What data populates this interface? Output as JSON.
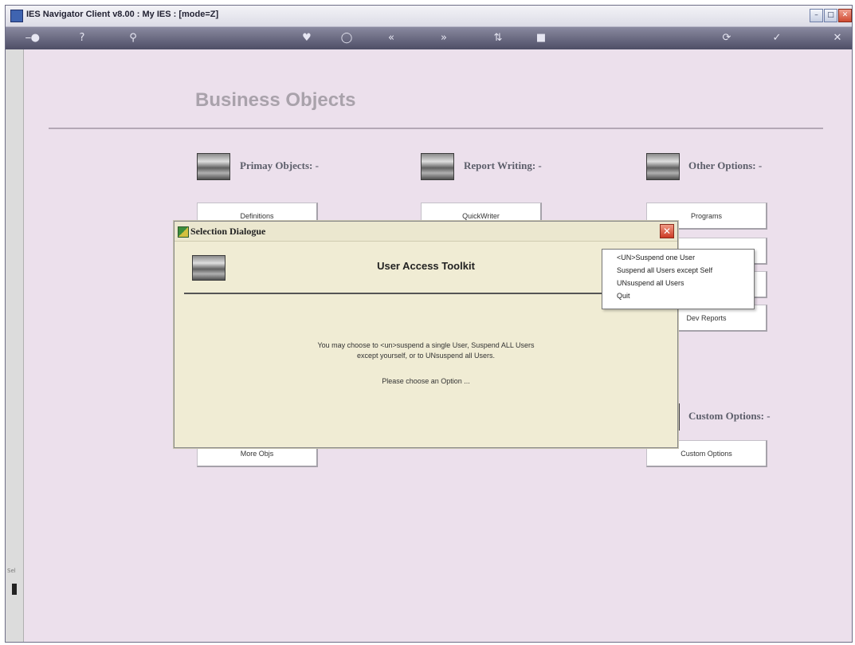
{
  "window": {
    "title": "IES Navigator Client v8.00 : My IES :       [mode=Z]"
  },
  "page": {
    "title": "Business Objects"
  },
  "sections": {
    "primary": {
      "title": "Primay Objects: -"
    },
    "report": {
      "title": "Report Writing: -"
    },
    "other": {
      "title": "Other Options: -"
    },
    "custom": {
      "title": "Custom Options: -"
    }
  },
  "buttons": {
    "definitions": "Definitions",
    "quickwriter": "QuickWriter",
    "programs": "Programs",
    "dev_reports": "Dev Reports",
    "more_objs": "More Objs",
    "custom_options": "Custom Options"
  },
  "sidebar": {
    "label": "Sel"
  },
  "dialog": {
    "title": "Selection Dialogue",
    "heading": "User Access Toolkit",
    "message_line1": "You may choose to <un>suspend a single User, Suspend ALL Users",
    "message_line2": "except yourself, or to UNsuspend all Users.",
    "prompt": "Please choose an Option ..."
  },
  "menu": {
    "items": [
      "<UN>Suspend one User",
      "Suspend all Users except Self",
      "UNsuspend all Users",
      "Quit"
    ]
  }
}
